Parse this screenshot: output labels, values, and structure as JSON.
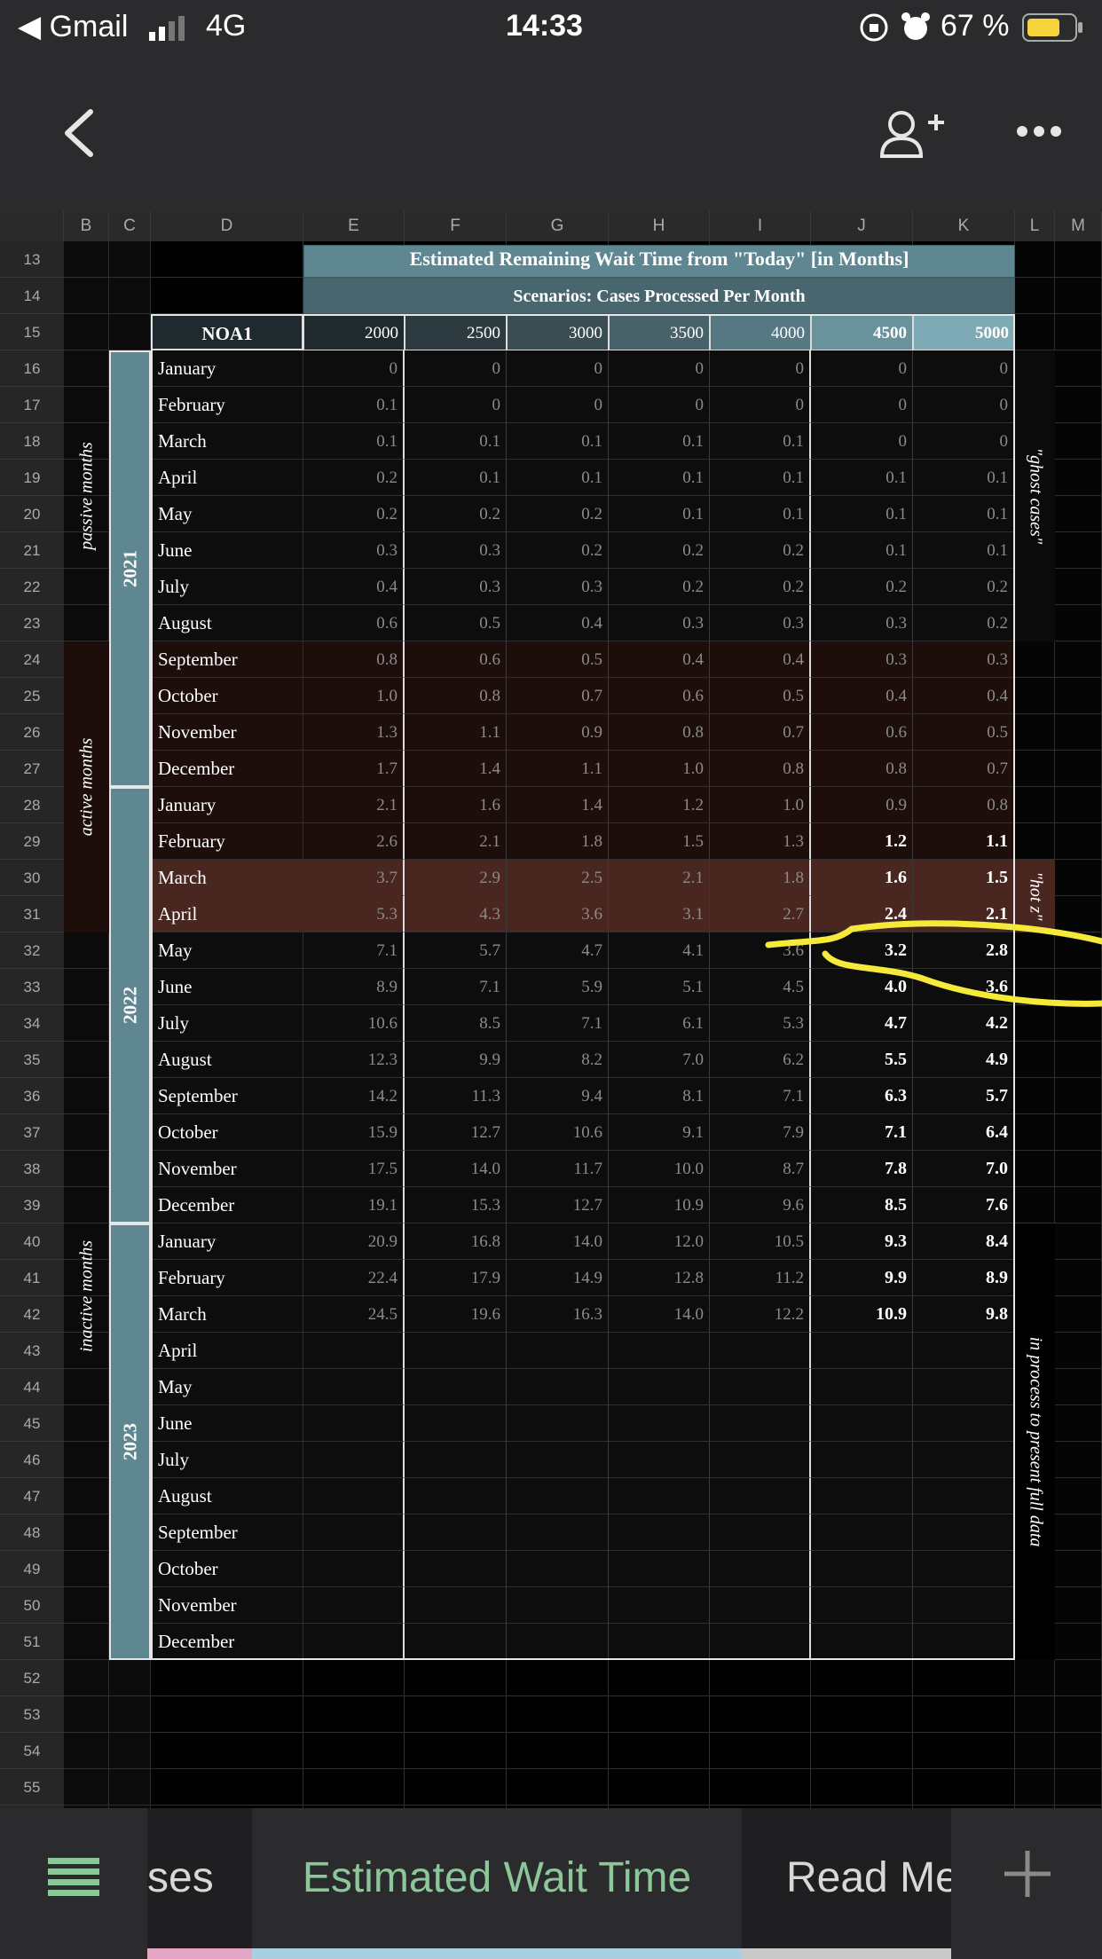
{
  "status": {
    "carrier": "Gmail",
    "network": "4G",
    "time": "14:33",
    "battery": "67 %"
  },
  "toolbar": {
    "back_icon": "back-arrow-icon",
    "add_person_icon": "person-add-icon",
    "more_icon": "more-dots-icon"
  },
  "columns": [
    "B",
    "C",
    "D",
    "E",
    "F",
    "G",
    "H",
    "I",
    "J",
    "K",
    "L",
    "M"
  ],
  "sheet": {
    "title": "Estimated Remaining Wait Time from \"Today\" [in Months]",
    "scenarios_label": "Scenarios: Cases Processed Per Month",
    "corner_label": "NOA1",
    "scenario_values": [
      "2000",
      "2500",
      "3000",
      "3500",
      "4000",
      "4500",
      "5000"
    ],
    "first_row": 13,
    "row_count": 44,
    "phase_labels": [
      "passive months",
      "active months",
      "inactive months"
    ],
    "years": [
      "2021",
      "2022",
      "2023"
    ],
    "side_notes": [
      "\"ghost cases\"",
      "\"hot z\"",
      "in process to present full data"
    ],
    "months": [
      "January",
      "February",
      "March",
      "April",
      "May",
      "June",
      "July",
      "August",
      "September",
      "October",
      "November",
      "December",
      "January",
      "February",
      "March",
      "April",
      "May",
      "June",
      "July",
      "August",
      "September",
      "October",
      "November",
      "December",
      "January",
      "February",
      "March",
      "April",
      "May",
      "June",
      "July",
      "August",
      "September",
      "October",
      "November",
      "December"
    ],
    "values": [
      [
        "0",
        "0",
        "0",
        "0",
        "0",
        "0",
        "0"
      ],
      [
        "0.1",
        "0",
        "0",
        "0",
        "0",
        "0",
        "0"
      ],
      [
        "0.1",
        "0.1",
        "0.1",
        "0.1",
        "0.1",
        "0",
        "0"
      ],
      [
        "0.2",
        "0.1",
        "0.1",
        "0.1",
        "0.1",
        "0.1",
        "0.1"
      ],
      [
        "0.2",
        "0.2",
        "0.2",
        "0.1",
        "0.1",
        "0.1",
        "0.1"
      ],
      [
        "0.3",
        "0.3",
        "0.2",
        "0.2",
        "0.2",
        "0.1",
        "0.1"
      ],
      [
        "0.4",
        "0.3",
        "0.3",
        "0.2",
        "0.2",
        "0.2",
        "0.2"
      ],
      [
        "0.6",
        "0.5",
        "0.4",
        "0.3",
        "0.3",
        "0.3",
        "0.2"
      ],
      [
        "0.8",
        "0.6",
        "0.5",
        "0.4",
        "0.4",
        "0.3",
        "0.3"
      ],
      [
        "1.0",
        "0.8",
        "0.7",
        "0.6",
        "0.5",
        "0.4",
        "0.4"
      ],
      [
        "1.3",
        "1.1",
        "0.9",
        "0.8",
        "0.7",
        "0.6",
        "0.5"
      ],
      [
        "1.7",
        "1.4",
        "1.1",
        "1.0",
        "0.8",
        "0.8",
        "0.7"
      ],
      [
        "2.1",
        "1.6",
        "1.4",
        "1.2",
        "1.0",
        "0.9",
        "0.8"
      ],
      [
        "2.6",
        "2.1",
        "1.8",
        "1.5",
        "1.3",
        "1.2",
        "1.1"
      ],
      [
        "3.7",
        "2.9",
        "2.5",
        "2.1",
        "1.8",
        "1.6",
        "1.5"
      ],
      [
        "5.3",
        "4.3",
        "3.6",
        "3.1",
        "2.7",
        "2.4",
        "2.1"
      ],
      [
        "7.1",
        "5.7",
        "4.7",
        "4.1",
        "3.6",
        "3.2",
        "2.8"
      ],
      [
        "8.9",
        "7.1",
        "5.9",
        "5.1",
        "4.5",
        "4.0",
        "3.6"
      ],
      [
        "10.6",
        "8.5",
        "7.1",
        "6.1",
        "5.3",
        "4.7",
        "4.2"
      ],
      [
        "12.3",
        "9.9",
        "8.2",
        "7.0",
        "6.2",
        "5.5",
        "4.9"
      ],
      [
        "14.2",
        "11.3",
        "9.4",
        "8.1",
        "7.1",
        "6.3",
        "5.7"
      ],
      [
        "15.9",
        "12.7",
        "10.6",
        "9.1",
        "7.9",
        "7.1",
        "6.4"
      ],
      [
        "17.5",
        "14.0",
        "11.7",
        "10.0",
        "8.7",
        "7.8",
        "7.0"
      ],
      [
        "19.1",
        "15.3",
        "12.7",
        "10.9",
        "9.6",
        "8.5",
        "7.6"
      ],
      [
        "20.9",
        "16.8",
        "14.0",
        "12.0",
        "10.5",
        "9.3",
        "8.4"
      ],
      [
        "22.4",
        "17.9",
        "14.9",
        "12.8",
        "11.2",
        "9.9",
        "8.9"
      ],
      [
        "24.5",
        "19.6",
        "16.3",
        "14.0",
        "12.2",
        "10.9",
        "9.8"
      ]
    ]
  },
  "tabs": [
    {
      "label": "ses",
      "active": false
    },
    {
      "label": "Estimated Wait Time",
      "active": true
    },
    {
      "label": "Read Me",
      "active": false
    }
  ],
  "colors": {
    "teal": "#5f8791",
    "active_tab_text": "#8cc79a",
    "highlight": "#f5e93a",
    "hot_row": "#4a2620",
    "active_row": "#1d0e0c"
  }
}
